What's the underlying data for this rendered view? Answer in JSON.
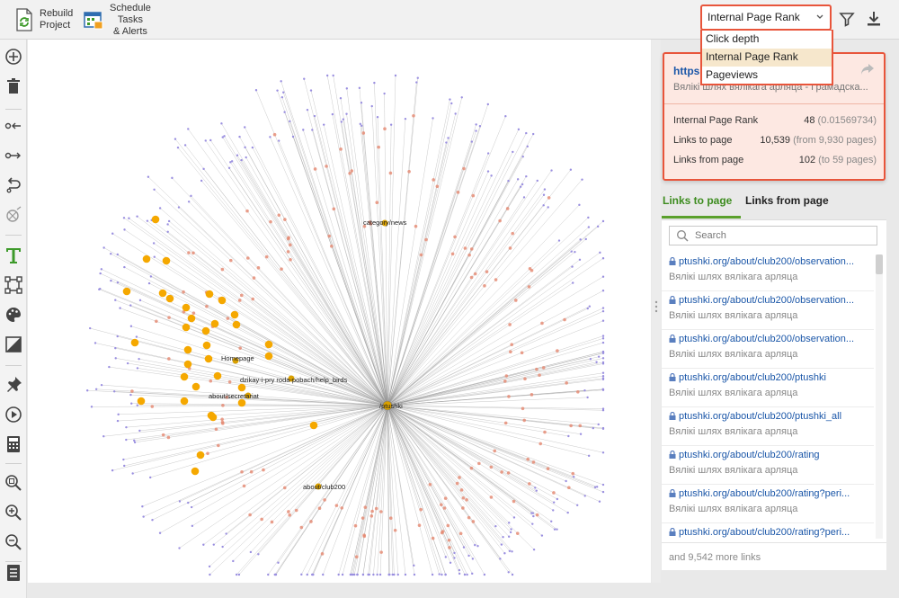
{
  "toolbar": {
    "rebuild_label_1": "Rebuild",
    "rebuild_label_2": "Project",
    "schedule_label_1": "Schedule",
    "schedule_label_2": "Tasks",
    "schedule_label_3": "& Alerts",
    "metric_selected": "Internal Page Rank",
    "metric_options": [
      "Click depth",
      "Internal Page Rank",
      "Pageviews"
    ]
  },
  "graph": {
    "labels": {
      "category_news": "category/news",
      "homepage": "Homepage",
      "help_birds": "dzikay-i-pry roda-pobach/help_birds",
      "secretariat": "about/secretariat",
      "club200": "about/club200",
      "center": "/ptushki"
    }
  },
  "info": {
    "url": "https",
    "title": "Вялікі шлях вялікага арляца - Грамадска...",
    "rows": [
      {
        "key": "Internal Page Rank",
        "value": "48",
        "sub": "(0.01569734)"
      },
      {
        "key": "Links to page",
        "value": "10,539",
        "sub": "(from 9,930 pages)"
      },
      {
        "key": "Links from page",
        "value": "102",
        "sub": "(to 59 pages)"
      }
    ]
  },
  "tabs": {
    "links_to": "Links to page",
    "links_from": "Links from page"
  },
  "search": {
    "placeholder": "Search"
  },
  "links": [
    {
      "url": "ptushki.org/about/club200/observation...",
      "title": "Вялікі шлях вялікага арляца"
    },
    {
      "url": "ptushki.org/about/club200/observation...",
      "title": "Вялікі шлях вялікага арляца"
    },
    {
      "url": "ptushki.org/about/club200/observation...",
      "title": "Вялікі шлях вялікага арляца"
    },
    {
      "url": "ptushki.org/about/club200/ptushki",
      "title": "Вялікі шлях вялікага арляца"
    },
    {
      "url": "ptushki.org/about/club200/ptushki_all",
      "title": "Вялікі шлях вялікага арляца"
    },
    {
      "url": "ptushki.org/about/club200/rating",
      "title": "Вялікі шлях вялікага арляца"
    },
    {
      "url": "ptushki.org/about/club200/rating?peri...",
      "title": "Вялікі шлях вялікага арляца"
    },
    {
      "url": "ptushki.org/about/club200/rating?peri...",
      "title": "Вялікі шлях вялікага арляца"
    }
  ],
  "more_links": "and 9,542 more links",
  "colors": {
    "accent": "#e8553b",
    "link": "#1a56a8",
    "active_tab": "#3d8c1f",
    "node_big": "#f5a800",
    "node_mid": "#e5876f",
    "node_small": "#9a8fe0"
  }
}
